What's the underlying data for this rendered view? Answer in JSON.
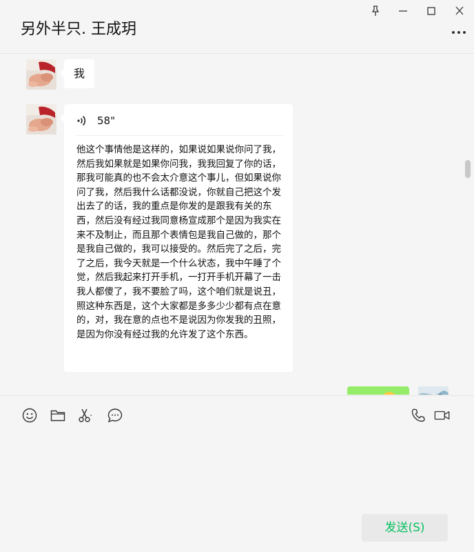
{
  "header": {
    "title": "另外半只. 王成玥"
  },
  "window_controls": {
    "pin": "pin-icon",
    "minimize": "minimize-icon",
    "maximize": "maximize-icon",
    "close": "close-icon"
  },
  "messages": [
    {
      "type": "text",
      "sender": "other",
      "text": "我"
    },
    {
      "type": "voice",
      "sender": "other",
      "duration": "58\"",
      "transcript": "他这个事情他是这样的，如果说如果说你问了我，然后我如果就是如果你问我，我我回复了你的话，那我可能真的也不会太介意这个事儿，但如果说你问了我，然后我什么话都没说，你就自己把这个发出去了的话，我的重点是你发的是跟我有关的东西，然后没有经过我同意杨宣成那个是因为我实在来不及制止，而且那个表情包是我自己做的，那个是我自己做的，我可以接受的。然后完了之后，完了之后，我今天就是一个什么状态，我中午睡了个觉，然后我起来打开手机，一打开手机开幕了一击我人都傻了，我不要脸了吗，这个咱们就是说丑，照这种东西是，这个大家都是多多少少都有点在意的，对，我在意的点也不是说因为你发我的丑照，是因为你没有经过我的允许发了这个东西。"
    },
    {
      "type": "emoji",
      "sender": "self"
    }
  ],
  "toolbar": {
    "left_tools": [
      "emoji-icon",
      "folder-icon",
      "scissors-icon",
      "chat-bubble-icon"
    ],
    "right_tools": [
      "phone-icon",
      "video-call-icon"
    ]
  },
  "composer": {
    "send_label": "发送(S)"
  },
  "colors": {
    "background": "#f5f5f5",
    "bubble_other": "#ffffff",
    "bubble_self": "#95ec69",
    "send_text": "#07c160"
  }
}
